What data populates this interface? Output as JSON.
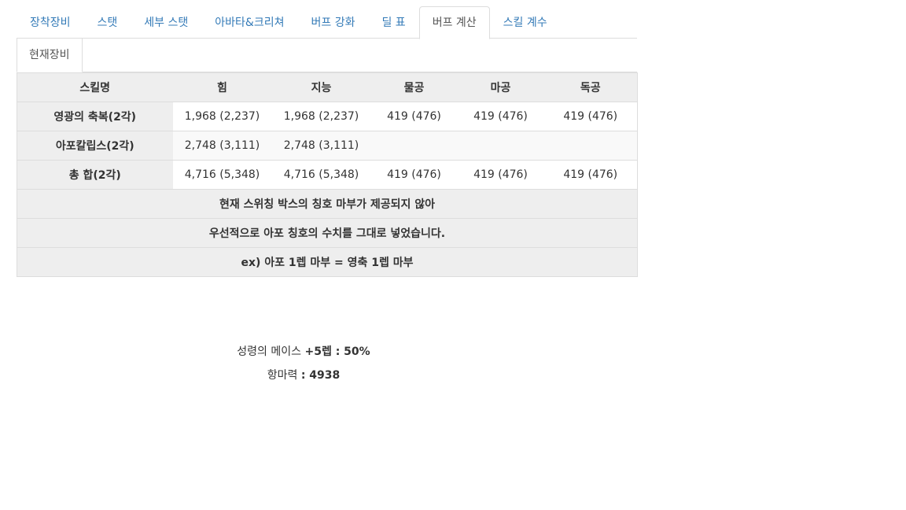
{
  "tabs": [
    {
      "label": "장착장비",
      "active": false
    },
    {
      "label": "스탯",
      "active": false
    },
    {
      "label": "세부 스탯",
      "active": false
    },
    {
      "label": "아바타&크리쳐",
      "active": false
    },
    {
      "label": "버프 강화",
      "active": false
    },
    {
      "label": "딜 표",
      "active": false
    },
    {
      "label": "버프 계산",
      "active": true
    },
    {
      "label": "스킬 계수",
      "active": false
    }
  ],
  "subtabs": [
    {
      "label": "현재장비",
      "active": true
    }
  ],
  "table": {
    "headers": [
      "스킬명",
      "힘",
      "지능",
      "물공",
      "마공",
      "독공"
    ],
    "rows": [
      {
        "name": "영광의 축복(2각)",
        "values": [
          "1,968 (2,237)",
          "1,968 (2,237)",
          "419 (476)",
          "419 (476)",
          "419 (476)"
        ]
      },
      {
        "name": "아포칼립스(2각)",
        "values": [
          "2,748 (3,111)",
          "2,748 (3,111)",
          "",
          "",
          ""
        ]
      },
      {
        "name": "총 합(2각)",
        "values": [
          "4,716 (5,348)",
          "4,716 (5,348)",
          "419 (476)",
          "419 (476)",
          "419 (476)"
        ]
      }
    ],
    "notes": [
      "현재 스위칭 박스의 칭호 마부가 제공되지 않아",
      "우선적으로 아포 칭호의 수치를 그대로 넣었습니다.",
      "ex) 아포 1렙 마부 = 영축 1렙 마부"
    ]
  },
  "extra": {
    "mace_label": "성령의 메이스 ",
    "mace_value": "+5렙 : 50%",
    "resist_label": "항마력 ",
    "resist_value": ": 4938"
  }
}
